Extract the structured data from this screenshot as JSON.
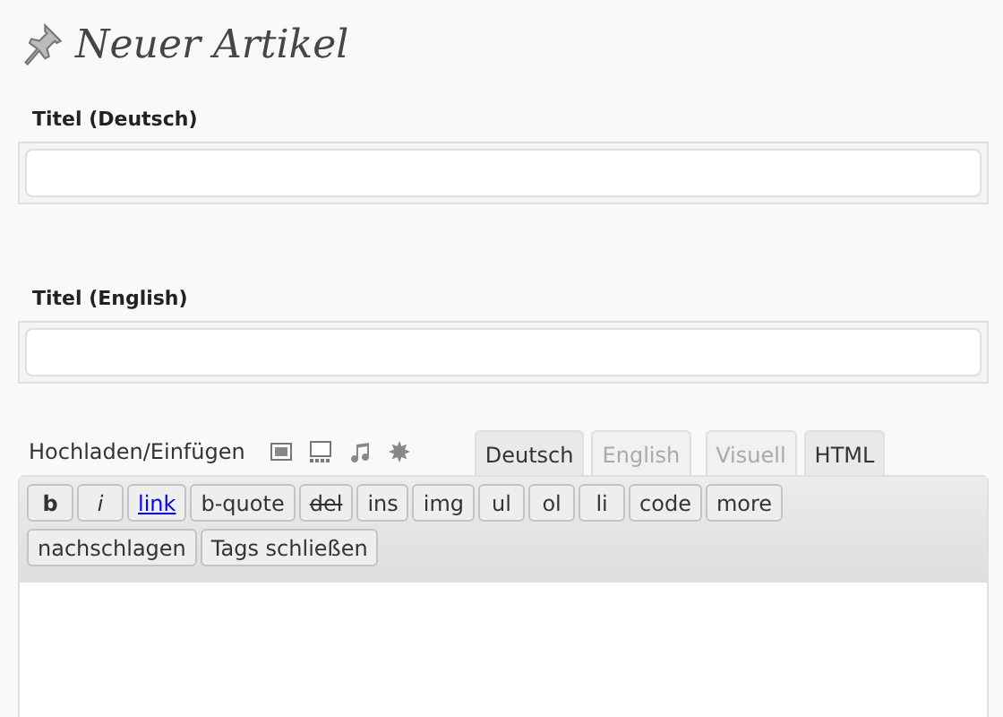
{
  "heading": "Neuer Artikel",
  "title_fields": [
    {
      "label": "Titel (Deutsch)"
    },
    {
      "label": "Titel (English)"
    }
  ],
  "media": {
    "label": "Hochladen/Einfügen",
    "icons": [
      {
        "kind": "image"
      },
      {
        "kind": "gallery"
      },
      {
        "kind": "music"
      },
      {
        "kind": "star"
      }
    ]
  },
  "language_tabs": [
    {
      "label": "Deutsch",
      "selected": true
    },
    {
      "label": "English",
      "selected": false
    }
  ],
  "mode_tabs": [
    {
      "label": "Visuell",
      "selected": false
    },
    {
      "label": "HTML",
      "selected": true
    }
  ],
  "quicktags": [
    [
      {
        "label": "b",
        "kind": "bold"
      },
      {
        "label": "i",
        "kind": "italic"
      },
      {
        "label": "link",
        "kind": "link"
      },
      {
        "label": "b-quote",
        "kind": "plain"
      },
      {
        "label": "del",
        "kind": "strike"
      },
      {
        "label": "ins",
        "kind": "plain"
      },
      {
        "label": "img",
        "kind": "plain"
      },
      {
        "label": "ul",
        "kind": "plain"
      },
      {
        "label": "ol",
        "kind": "plain"
      },
      {
        "label": "li",
        "kind": "plain"
      },
      {
        "label": "code",
        "kind": "plain"
      },
      {
        "label": "more",
        "kind": "plain"
      }
    ],
    [
      {
        "label": "nachschlagen",
        "kind": "plain"
      },
      {
        "label": "Tags schließen",
        "kind": "plain"
      }
    ]
  ]
}
